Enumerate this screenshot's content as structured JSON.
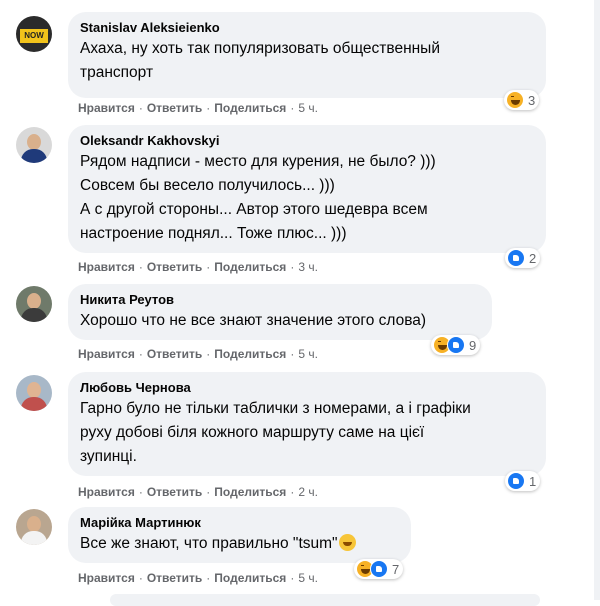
{
  "top_partial": {
    "actions": [
      "Нравится",
      "Ответить",
      "Поделиться",
      "5 ч."
    ]
  },
  "comments": [
    {
      "author": "Stanislav Aleksieienko",
      "avatar_label": "NOW",
      "lines": [
        "Ахаха, ну хоть так популяризовать общественный",
        "транспорт"
      ],
      "actions": {
        "like": "Нравится",
        "reply": "Ответить",
        "share": "Поделиться",
        "time": "5 ч."
      },
      "reactions": {
        "icons": [
          "haha-icon"
        ],
        "count": "3"
      }
    },
    {
      "author": "Oleksandr Kakhovskyi",
      "lines": [
        "Рядом надписи - место для курения, не было? )))",
        "Совсем бы весело получилось... )))",
        "А с другой стороны... Автор этого шедевра всем",
        "настроение поднял... Тоже плюс... )))"
      ],
      "actions": {
        "like": "Нравится",
        "reply": "Ответить",
        "share": "Поделиться",
        "time": "3 ч."
      },
      "reactions": {
        "icons": [
          "like-icon"
        ],
        "count": "2"
      }
    },
    {
      "author": "Никита Реутов",
      "lines": [
        "Хорошо что не все знают значение этого слова)"
      ],
      "actions": {
        "like": "Нравится",
        "reply": "Ответить",
        "share": "Поделиться",
        "time": "5 ч."
      },
      "reactions": {
        "icons": [
          "haha-icon",
          "like-icon"
        ],
        "count": "9"
      }
    },
    {
      "author": "Любовь Чернова",
      "lines": [
        "Гарно було не тільки таблички з номерами, а і графіки",
        "руху добові біля кожного маршруту саме на цієї",
        "зупинці."
      ],
      "actions": {
        "like": "Нравится",
        "reply": "Ответить",
        "share": "Поделиться",
        "time": "2 ч."
      },
      "reactions": {
        "icons": [
          "like-icon"
        ],
        "count": "1"
      }
    },
    {
      "author": "Марійка Мартинюк",
      "lines": [
        "Все же знают, что правильно \"tsum\""
      ],
      "actions": {
        "like": "Нравится",
        "reply": "Ответить",
        "share": "Поделиться",
        "time": "5 ч."
      },
      "reactions": {
        "icons": [
          "haha-icon",
          "like-icon"
        ],
        "count": "7"
      }
    }
  ],
  "colors": {
    "bubble": "#f0f2f5",
    "meta": "#65676b",
    "like": "#1877f2",
    "haha": "#f7b125"
  }
}
